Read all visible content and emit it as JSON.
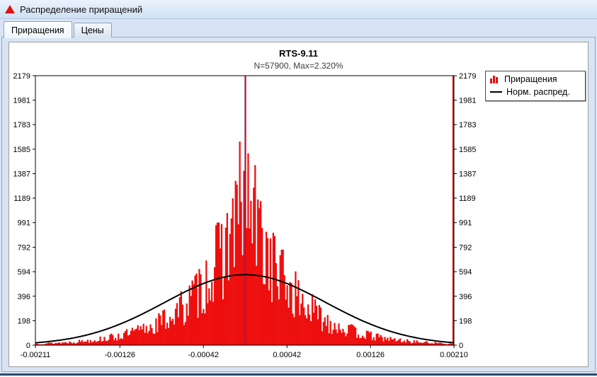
{
  "window": {
    "title": "Распределение приращений"
  },
  "tabs": [
    {
      "label": "Приращения",
      "active": true
    },
    {
      "label": "Цены",
      "active": false
    }
  ],
  "chart_data": {
    "type": "bar",
    "subtype": "histogram-with-normal-curve",
    "title": "RTS-9.11",
    "subtitle": "N=57900, Max=2.320%",
    "n_samples": 57900,
    "max_increment": "2.320%",
    "xlim": [
      -0.00211,
      0.0021
    ],
    "ylim": [
      0,
      2179
    ],
    "x_ticks": [
      -0.00211,
      -0.00126,
      -0.00042,
      0.00042,
      0.00126,
      0.0021
    ],
    "x_tick_labels": [
      "-0.00211",
      "-0.00126",
      "-0.00042",
      "0.00042",
      "0.00126",
      "0.00210"
    ],
    "y_ticks": [
      0,
      198,
      396,
      594,
      792,
      991,
      1189,
      1387,
      1585,
      1783,
      1981,
      2179
    ],
    "y_tick_labels": [
      "0",
      "198",
      "396",
      "594",
      "792",
      "991",
      "1189",
      "1387",
      "1585",
      "1783",
      "1981",
      "2179"
    ],
    "grid": false,
    "legend_position": "top-right",
    "legend": [
      {
        "label": "Приращения",
        "type": "bars",
        "color": "#e31212"
      },
      {
        "label": "Норм. распред.",
        "type": "line",
        "color": "#000000"
      }
    ],
    "histogram": {
      "color": "#ee0f0f",
      "shape": "laplace-like",
      "peak": 1320,
      "laplace_scale": 0.00045,
      "center": 0,
      "bins": 300,
      "noise_min": 0.45,
      "noise_max": 1.42,
      "seed": 13,
      "center_spike_height": 2179,
      "right_edge_spike_height": 2179
    },
    "normal_curve": {
      "color": "#000000",
      "peak": 570,
      "mean": 0,
      "sigma": 0.00081
    },
    "center_marker_color": "#2233bb"
  }
}
